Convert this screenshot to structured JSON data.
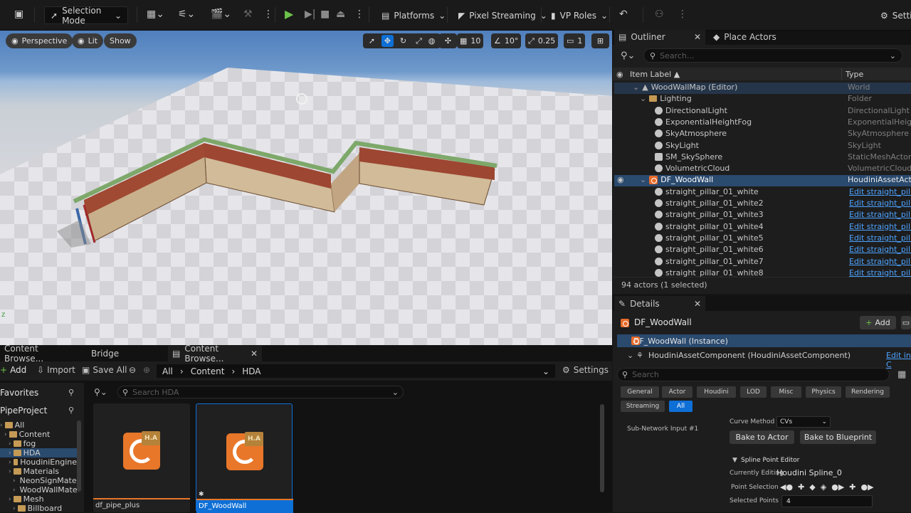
{
  "toolbar": {
    "mode_label": "Selection Mode",
    "platforms": "Platforms",
    "pixel_streaming": "Pixel Streaming",
    "vp_roles": "VP Roles",
    "settings": "Setti"
  },
  "viewport": {
    "perspective": "Perspective",
    "lit": "Lit",
    "show": "Show",
    "grid_snap": "10",
    "rot_snap": "10°",
    "scale_snap": "0.25",
    "camera_speed": "1"
  },
  "outliner": {
    "tab": "Outliner",
    "place_tab": "Place Actors",
    "search_placeholder": "Search...",
    "col_label": "Item Label ▲",
    "col_type": "Type",
    "rows": [
      {
        "label": "WoodWallMap (Editor)",
        "type": "World"
      },
      {
        "label": "Lighting",
        "type": "Folder"
      },
      {
        "label": "DirectionalLight",
        "type": "DirectionalLight"
      },
      {
        "label": "ExponentialHeightFog",
        "type": "ExponentialHeightFog"
      },
      {
        "label": "SkyAtmosphere",
        "type": "SkyAtmosphere"
      },
      {
        "label": "SkyLight",
        "type": "SkyLight"
      },
      {
        "label": "SM_SkySphere",
        "type": "StaticMeshActor"
      },
      {
        "label": "VolumetricCloud",
        "type": "VolumetricCloud"
      },
      {
        "label": "DF_WoodWall",
        "type": "HoudiniAssetActor"
      },
      {
        "label": "straight_pillar_01_white",
        "type": "Edit straight_pillar"
      },
      {
        "label": "straight_pillar_01_white2",
        "type": "Edit straight_pillar"
      },
      {
        "label": "straight_pillar_01_white3",
        "type": "Edit straight_pillar"
      },
      {
        "label": "straight_pillar_01_white4",
        "type": "Edit straight_pillar"
      },
      {
        "label": "straight_pillar_01_white5",
        "type": "Edit straight_pillar"
      },
      {
        "label": "straight_pillar_01_white6",
        "type": "Edit straight_pillar"
      },
      {
        "label": "straight_pillar_01_white7",
        "type": "Edit straight_pillar"
      },
      {
        "label": "straight_pillar_01_white8",
        "type": "Edit straight_pillar"
      }
    ],
    "status": "94 actors (1 selected)"
  },
  "details": {
    "tab": "Details",
    "actor_name": "DF_WoodWall",
    "add_label": "Add",
    "instance": "DF_WoodWall (Instance)",
    "component": "HoudiniAssetComponent (HoudiniAssetComponent)",
    "edit_in": "Edit in C",
    "search_placeholder": "Search",
    "filters": [
      "General",
      "Actor",
      "Houdini",
      "LOD",
      "Misc",
      "Physics",
      "Rendering",
      "Streaming",
      "All"
    ],
    "sub_network": "Sub-Network Input #1",
    "curve_method_label": "Curve Method",
    "curve_method_value": "CVs",
    "bake_actor": "Bake to Actor",
    "bake_blueprint": "Bake to Blueprint",
    "spline_editor": "Spline Point Editor",
    "currently_editing_label": "Currently Editing",
    "currently_editing_value": "Houdini Spline_0",
    "point_selection": "Point Selection",
    "selected_points_label": "Selected Points",
    "selected_points_value": "4"
  },
  "content": {
    "tab1": "Content Browse...",
    "tab2": "Bridge",
    "tab3": "Content Browse...",
    "add": "Add",
    "import": "Import",
    "save_all": "Save All",
    "crumb_all": "All",
    "crumb_content": "Content",
    "crumb_hda": "HDA",
    "settings": "Settings",
    "favorites": "Favorites",
    "project": "PipeProject",
    "search_placeholder": "Search HDA",
    "tree": [
      {
        "label": "All",
        "indent": 0
      },
      {
        "label": "Content",
        "indent": 1
      },
      {
        "label": "fog",
        "indent": 2
      },
      {
        "label": "HDA",
        "indent": 2
      },
      {
        "label": "HoudiniEngine",
        "indent": 2
      },
      {
        "label": "Materials",
        "indent": 2
      },
      {
        "label": "NeonSignMater",
        "indent": 3
      },
      {
        "label": "WoodWallMate",
        "indent": 3
      },
      {
        "label": "Mesh",
        "indent": 2
      },
      {
        "label": "Billboard",
        "indent": 3
      }
    ],
    "assets": [
      {
        "name": "df_pipe_plus",
        "badge": "H.A",
        "selected": false
      },
      {
        "name": "DF_WoodWall",
        "badge": "H.A",
        "selected": true
      }
    ]
  },
  "colors": {
    "accent": "#0e6fd6",
    "orange": "#e8772a",
    "selection": "#2a4a6e",
    "link": "#4da3ff"
  }
}
